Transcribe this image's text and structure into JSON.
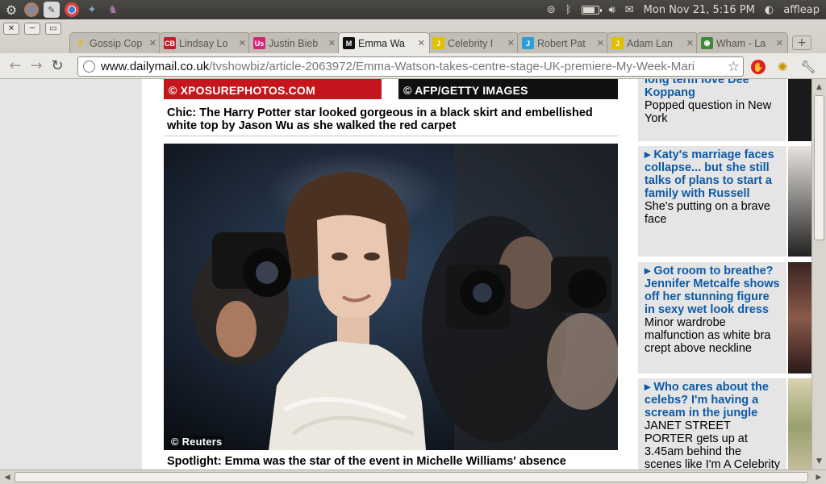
{
  "panel": {
    "clock": "Mon Nov 21,  5:16 PM",
    "user": "affleap",
    "battery_level": 0.85,
    "left_icons": [
      "ubuntu-logo-icon",
      "firefox-icon",
      "text-editor-icon",
      "chrome-icon",
      "puzzle-icon",
      "pidgin-icon"
    ],
    "right_icons": [
      "network-icon",
      "bluetooth-icon",
      "battery-icon",
      "volume-icon",
      "mail-icon",
      "user-icon"
    ]
  },
  "browser": {
    "tabs": [
      {
        "label": "Gossip Cop",
        "favicon": "star",
        "fav_text": "★",
        "fav_color": "#e7b715"
      },
      {
        "label": "Lindsay Lo",
        "favicon": "cb",
        "fav_text": "CB",
        "fav_color": "#c0202e"
      },
      {
        "label": "Justin Bieb",
        "favicon": "us",
        "fav_text": "Us",
        "fav_color": "#d2267a"
      },
      {
        "label": "Emma Wa",
        "favicon": "dm",
        "fav_text": "M",
        "fav_color": "#111111",
        "active": true
      },
      {
        "label": "Celebrity I",
        "favicon": "j",
        "fav_text": "J",
        "fav_color": "#e0c000"
      },
      {
        "label": "Robert Pat",
        "favicon": "jj",
        "fav_text": "J",
        "fav_color": "#2a9fd8"
      },
      {
        "label": "Adam Lan",
        "favicon": "j",
        "fav_text": "J",
        "fav_color": "#e0c000"
      },
      {
        "label": "Wham - La",
        "favicon": "wham",
        "fav_text": "◉",
        "fav_color": "#3a8a3a"
      }
    ],
    "url_host": "www.dailymail.co.uk",
    "url_path": "/tvshowbiz/article-2063972/Emma-Watson-takes-centre-stage-UK-premiere-My-Week-Mari"
  },
  "article": {
    "top_credit_left": "© XPOSUREPHOTOS.COM",
    "top_credit_right": "© AFP/GETTY IMAGES",
    "caption1": "Chic: The Harry Potter star looked gorgeous in a black skirt and embellished white top by Jason Wu as she walked the red carpet",
    "photo_credit": "© Reuters",
    "caption2": "Spotlight: Emma was the star of the event in Michelle Williams' absence"
  },
  "sidebar": {
    "stories": [
      {
        "headline": "long term love Dee Koppang",
        "sub": "Popped question in New York"
      },
      {
        "headline": "Katy's marriage faces collapse... but she still talks of plans to start a family with Russell",
        "sub": "She's putting on a brave face"
      },
      {
        "headline": "Got room to breathe? Jennifer Metcalfe shows off her stunning figure in sexy wet look dress",
        "sub": "Minor wardrobe malfunction as white bra crept above neckline"
      },
      {
        "headline": "Who cares about the celebs? I'm having a scream in the jungle",
        "sub": "JANET STREET PORTER gets up at 3.45am behind the scenes like I'm A Celebrity"
      }
    ]
  }
}
